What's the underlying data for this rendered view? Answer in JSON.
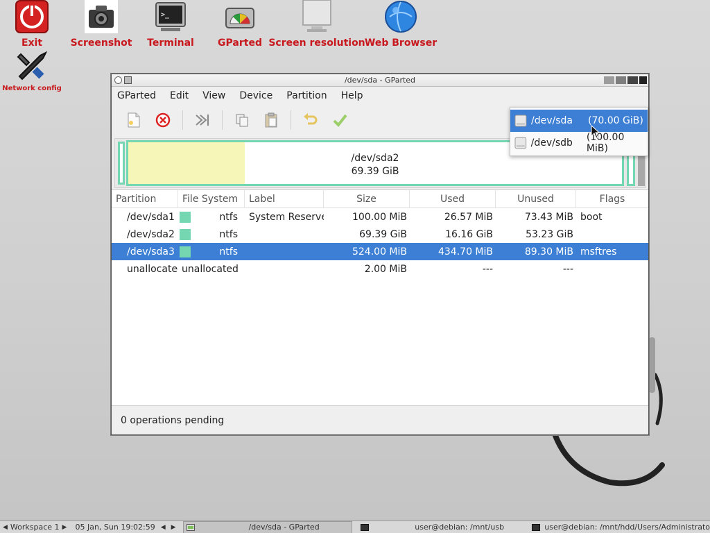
{
  "desktop": {
    "icons": [
      {
        "label": "Exit"
      },
      {
        "label": "Screenshot"
      },
      {
        "label": "Terminal"
      },
      {
        "label": "GParted"
      },
      {
        "label": "Screen resolution"
      },
      {
        "label": "Web Browser"
      },
      {
        "label": "Network config"
      }
    ]
  },
  "window": {
    "title": "/dev/sda - GParted",
    "menu": [
      "GParted",
      "Edit",
      "View",
      "Device",
      "Partition",
      "Help"
    ],
    "diskmap": {
      "name": "/dev/sda2",
      "size": "69.39 GiB"
    },
    "table": {
      "headers": [
        "Partition",
        "File System",
        "Label",
        "Size",
        "Used",
        "Unused",
        "Flags"
      ],
      "rows": [
        {
          "partition": "/dev/sda1",
          "fs": "ntfs",
          "label": "System Reserved",
          "size": "100.00 MiB",
          "used": "26.57 MiB",
          "unused": "73.43 MiB",
          "flags": "boot"
        },
        {
          "partition": "/dev/sda2",
          "fs": "ntfs",
          "label": "",
          "size": "69.39 GiB",
          "used": "16.16 GiB",
          "unused": "53.23 GiB",
          "flags": ""
        },
        {
          "partition": "/dev/sda3",
          "fs": "ntfs",
          "label": "",
          "size": "524.00 MiB",
          "used": "434.70 MiB",
          "unused": "89.30 MiB",
          "flags": "msftres"
        },
        {
          "partition": "unallocated",
          "fs": "unallocated",
          "label": "",
          "size": "2.00 MiB",
          "used": "---",
          "unused": "---",
          "flags": ""
        }
      ]
    },
    "status": "0 operations pending"
  },
  "device_popup": {
    "items": [
      {
        "device": "/dev/sda",
        "size": "(70.00 GiB)"
      },
      {
        "device": "/dev/sdb",
        "size": "(100.00 MiB)"
      }
    ]
  },
  "taskbar": {
    "workspace": "Workspace 1",
    "clock": "05 Jan, Sun 19:02:59",
    "tasks": [
      "/dev/sda - GParted",
      "user@debian: /mnt/usb",
      "user@debian: /mnt/hdd/Users/Administrato"
    ]
  },
  "colors": {
    "selection": "#3c7fd4",
    "ntfs": "#75d6b2",
    "unallocated": "#a8a8a8",
    "used_space": "#f6f6b8",
    "desktop_label": "#c8191e"
  }
}
